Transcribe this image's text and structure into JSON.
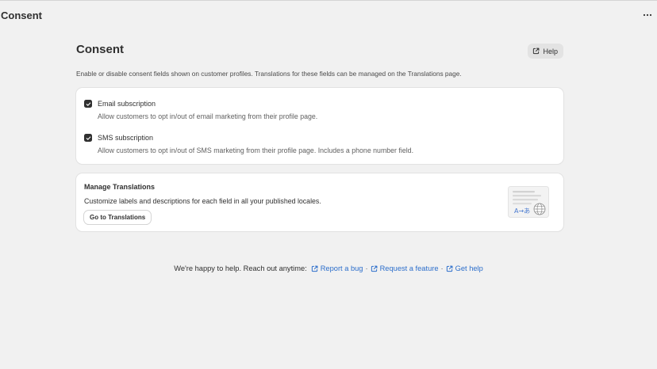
{
  "app": {
    "title": "Consent"
  },
  "page": {
    "title": "Consent",
    "help_label": "Help",
    "description": "Enable or disable consent fields shown on customer profiles. Translations for these fields can be managed on the Translations page."
  },
  "consent": {
    "options": [
      {
        "label": "Email subscription",
        "help": "Allow customers to opt in/out of email marketing from their profile page.",
        "checked": true
      },
      {
        "label": "SMS subscription",
        "help": "Allow customers to opt in/out of SMS marketing from their profile page. Includes a phone number field.",
        "checked": true
      }
    ]
  },
  "translations": {
    "title": "Manage Translations",
    "description": "Customize labels and descriptions for each field in all your published locales.",
    "button_label": "Go to Translations",
    "illustration_text": "A→あ"
  },
  "footer": {
    "lead": "We're happy to help. Reach out anytime:",
    "links": [
      {
        "label": "Report a bug"
      },
      {
        "label": "Request a feature"
      },
      {
        "label": "Get help"
      }
    ],
    "separator": "·"
  },
  "colors": {
    "link": "#2c6ecb",
    "checkbox": "#303030",
    "background": "#f1f1f1"
  },
  "icons": [
    "more-horizontal-icon",
    "external-link-icon",
    "checkmark-icon",
    "globe-icon"
  ]
}
